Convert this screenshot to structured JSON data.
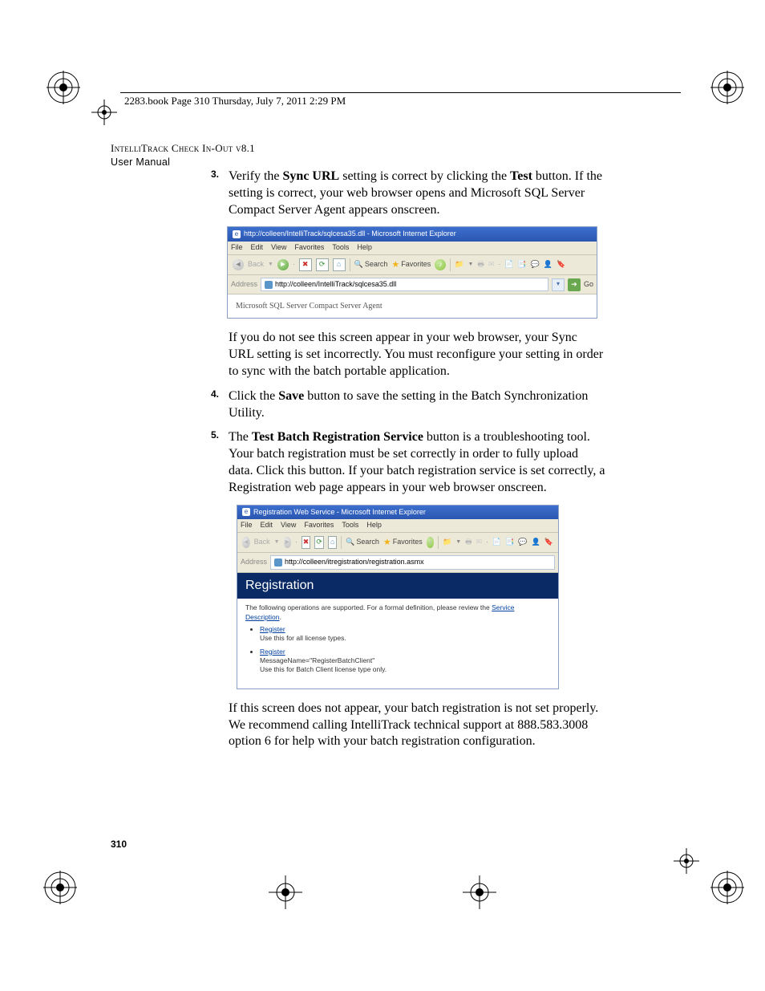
{
  "header": {
    "line": "2283.book  Page 310  Thursday, July 7, 2011  2:29 PM"
  },
  "title": {
    "product": "IntelliTrack Check In-Out v8.1",
    "subtitle": "User Manual"
  },
  "steps": {
    "s3": {
      "num": "3.",
      "text_pre": "Verify the ",
      "bold1": "Sync URL",
      "text_mid": " setting is correct by clicking the ",
      "bold2": "Test",
      "text_post": " button. If the setting is correct, your web browser opens and Microsoft SQL Server Compact Server Agent appears onscreen."
    },
    "s3_followup": "If you do not see this screen appear in your web browser, your Sync URL setting is set incorrectly. You must reconfigure your setting in order to sync with the batch portable application.",
    "s4": {
      "num": "4.",
      "text_pre": "Click the ",
      "bold1": "Save",
      "text_post": " button to save the setting in the Batch Synchronization Utility."
    },
    "s5": {
      "num": "5.",
      "text_pre": "The ",
      "bold1": "Test Batch Registration Service",
      "text_post": " button is a troubleshooting tool. Your batch registration must be set correctly in order to fully upload data. Click this button. If your batch registration service is set correctly, a Registration web page appears in your web browser onscreen."
    },
    "s5_followup": "If this screen does not appear, your batch registration is not set properly. We recommend calling IntelliTrack technical support at 888.583.3008 option 6 for help with your batch registration configuration."
  },
  "ie1": {
    "title": "http://colleen/IntelliTrack/sqlcesa35.dll - Microsoft Internet Explorer",
    "menu": [
      "File",
      "Edit",
      "View",
      "Favorites",
      "Tools",
      "Help"
    ],
    "toolbar": {
      "back": "Back",
      "search": "Search",
      "favorites": "Favorites"
    },
    "address_label": "Address",
    "address_value": "http://colleen/IntelliTrack/sqlcesa35.dll",
    "go": "Go",
    "body": "Microsoft SQL Server Compact Server Agent"
  },
  "ie2": {
    "title": "Registration Web Service - Microsoft Internet Explorer",
    "menu": [
      "File",
      "Edit",
      "View",
      "Favorites",
      "Tools",
      "Help"
    ],
    "toolbar": {
      "back": "Back",
      "search": "Search",
      "favorites": "Favorites"
    },
    "address_label": "Address",
    "address_value": "http://colleen/itregistration/registration.asmx",
    "reg_heading": "Registration",
    "reg_intro_pre": "The following operations are supported. For a formal definition, please review the ",
    "reg_intro_link": "Service Description",
    "reg_intro_post": ".",
    "items": [
      {
        "link": "Register",
        "desc": "Use this for all license types."
      },
      {
        "link": "Register",
        "desc1": "MessageName=\"RegisterBatchClient\"",
        "desc2": "Use this for Batch Client license type only."
      }
    ]
  },
  "page_number": "310"
}
